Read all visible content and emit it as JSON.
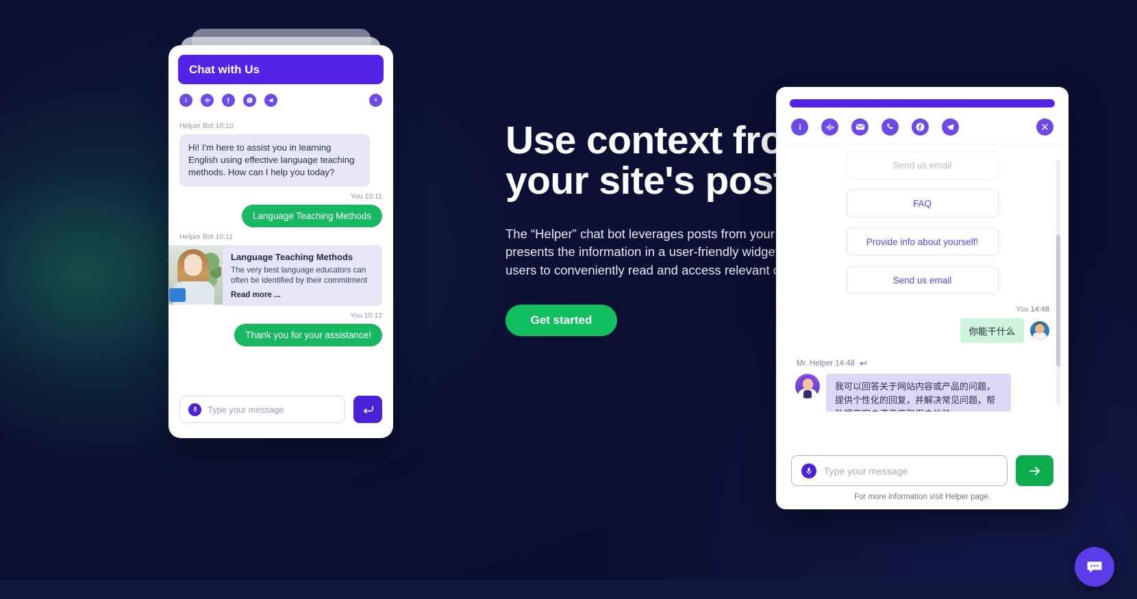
{
  "hero": {
    "title": "Use context from\nyour site's post",
    "subtitle": "The “Helper” chat bot leverages posts from your w\npresents the information in a user-friendly widget\nusers to conveniently read and access relevant co",
    "cta_label": "Get started",
    "accent_green": "#12bf5f",
    "accent_purple": "#5323e8",
    "background": "#0b1034"
  },
  "left_widget": {
    "header_title": "Chat with Us",
    "icons": [
      {
        "name": "info-icon",
        "glyph": "i"
      },
      {
        "name": "voice-wave-icon",
        "glyph": "waves"
      },
      {
        "name": "facebook-icon",
        "glyph": "f"
      },
      {
        "name": "whatsapp-icon",
        "glyph": "phone"
      },
      {
        "name": "telegram-icon",
        "glyph": "send"
      }
    ],
    "close_label": "×",
    "messages": [
      {
        "meta": "Helper Bot 10:10",
        "side": "bot",
        "text": "Hi! I'm here to assist you in learning English using effective language teaching methods. How can I help you today?"
      },
      {
        "meta": "You 10:11",
        "side": "user",
        "text": "Language Teaching Methods"
      },
      {
        "meta": "Helper Bot 10:11",
        "side": "post",
        "post_title": "Language Teaching Methods",
        "post_text": "The very best language educators can often be identified by their commitment",
        "read_more": "Read more ..."
      },
      {
        "meta": "You 10:12",
        "side": "user",
        "text": "Thank you for your assistance!"
      }
    ],
    "input_placeholder": "Type your message",
    "input_value": "",
    "send_label": "↵"
  },
  "right_widget": {
    "icons": [
      {
        "name": "info-icon",
        "glyph": "i"
      },
      {
        "name": "voice-wave-icon",
        "glyph": "waves"
      },
      {
        "name": "email-icon",
        "glyph": "mail"
      },
      {
        "name": "phone-icon",
        "glyph": "phone"
      },
      {
        "name": "facebook-icon",
        "glyph": "f"
      },
      {
        "name": "telegram-icon",
        "glyph": "send"
      }
    ],
    "close_label": "×",
    "options": [
      {
        "label": "Send us email",
        "faded": true
      },
      {
        "label": "FAQ",
        "faded": false
      },
      {
        "label": "Provide info about yourself!",
        "faded": false
      },
      {
        "label": "Send us email",
        "faded": false
      }
    ],
    "user_meta_name": "You",
    "user_meta_time": "14:48",
    "user_message": "你能干什么",
    "bot_meta": "Mr. Helper 14:48",
    "bot_message": "我可以回答关于网站内容或产品的问题，提供个性化的回复，并解决常见问题，帮助提高客户满意度和用户体验。",
    "input_placeholder": "Type your message",
    "input_value": "",
    "send_label": "→",
    "footer_text": "For more information visit Helper page."
  },
  "fab": {
    "name": "chat-bubble-fab",
    "color": "#5c3ce8"
  }
}
